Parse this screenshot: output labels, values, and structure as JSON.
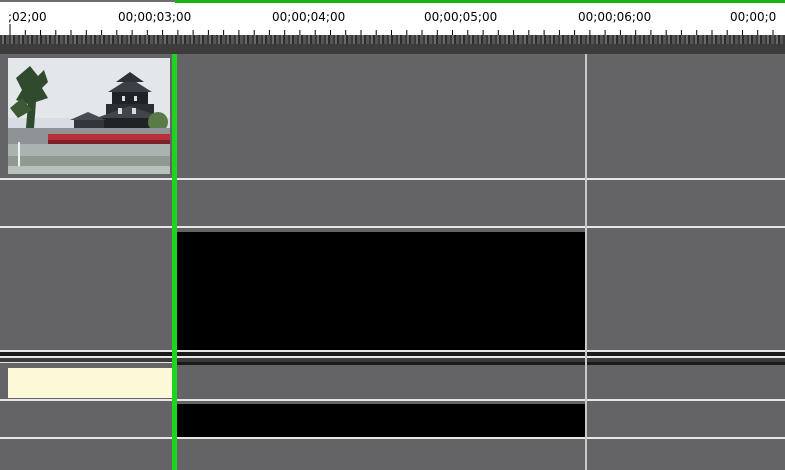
{
  "ruler": {
    "labels": [
      {
        "text": ";02;00"
      },
      {
        "text": "00;00;03;00"
      },
      {
        "text": "00;00;04;00"
      },
      {
        "text": "00;00;05;00"
      },
      {
        "text": "00;00;06;00"
      },
      {
        "text": "00;00;0"
      }
    ]
  },
  "colors": {
    "track_bg": "#646366",
    "playhead": "#1ed41e",
    "clip_black": "#000000",
    "clip_cream": "#fcf8d8",
    "separator": "#e6e6e6"
  },
  "tracks": {
    "video_clip_thumbnail": "castle-photo-thumbnail"
  }
}
